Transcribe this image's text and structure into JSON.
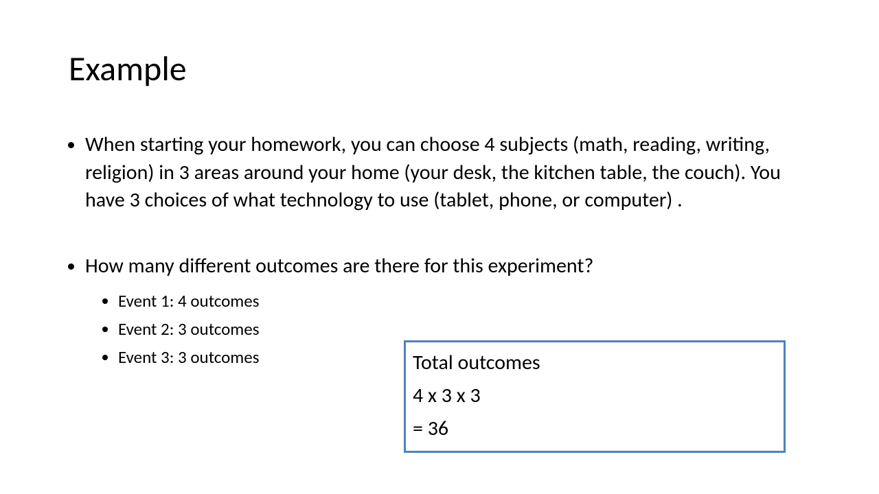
{
  "title": "Example",
  "bullets": {
    "problem": "When starting your homework, you can choose 4 subjects (math, reading, writing, religion) in 3 areas around your home (your desk, the kitchen table, the couch). You have 3 choices of what technology to use (tablet, phone, or computer) .",
    "question": "How many different outcomes are there for this experiment?",
    "events": {
      "e1": "Event 1: 4 outcomes",
      "e2": "Event 2: 3 outcomes",
      "e3": "Event 3: 3 outcomes"
    }
  },
  "answer": {
    "label": "Total outcomes",
    "expression": "4 x 3 x 3",
    "result": "= 36"
  },
  "colors": {
    "box_border": "#4f81bd"
  }
}
